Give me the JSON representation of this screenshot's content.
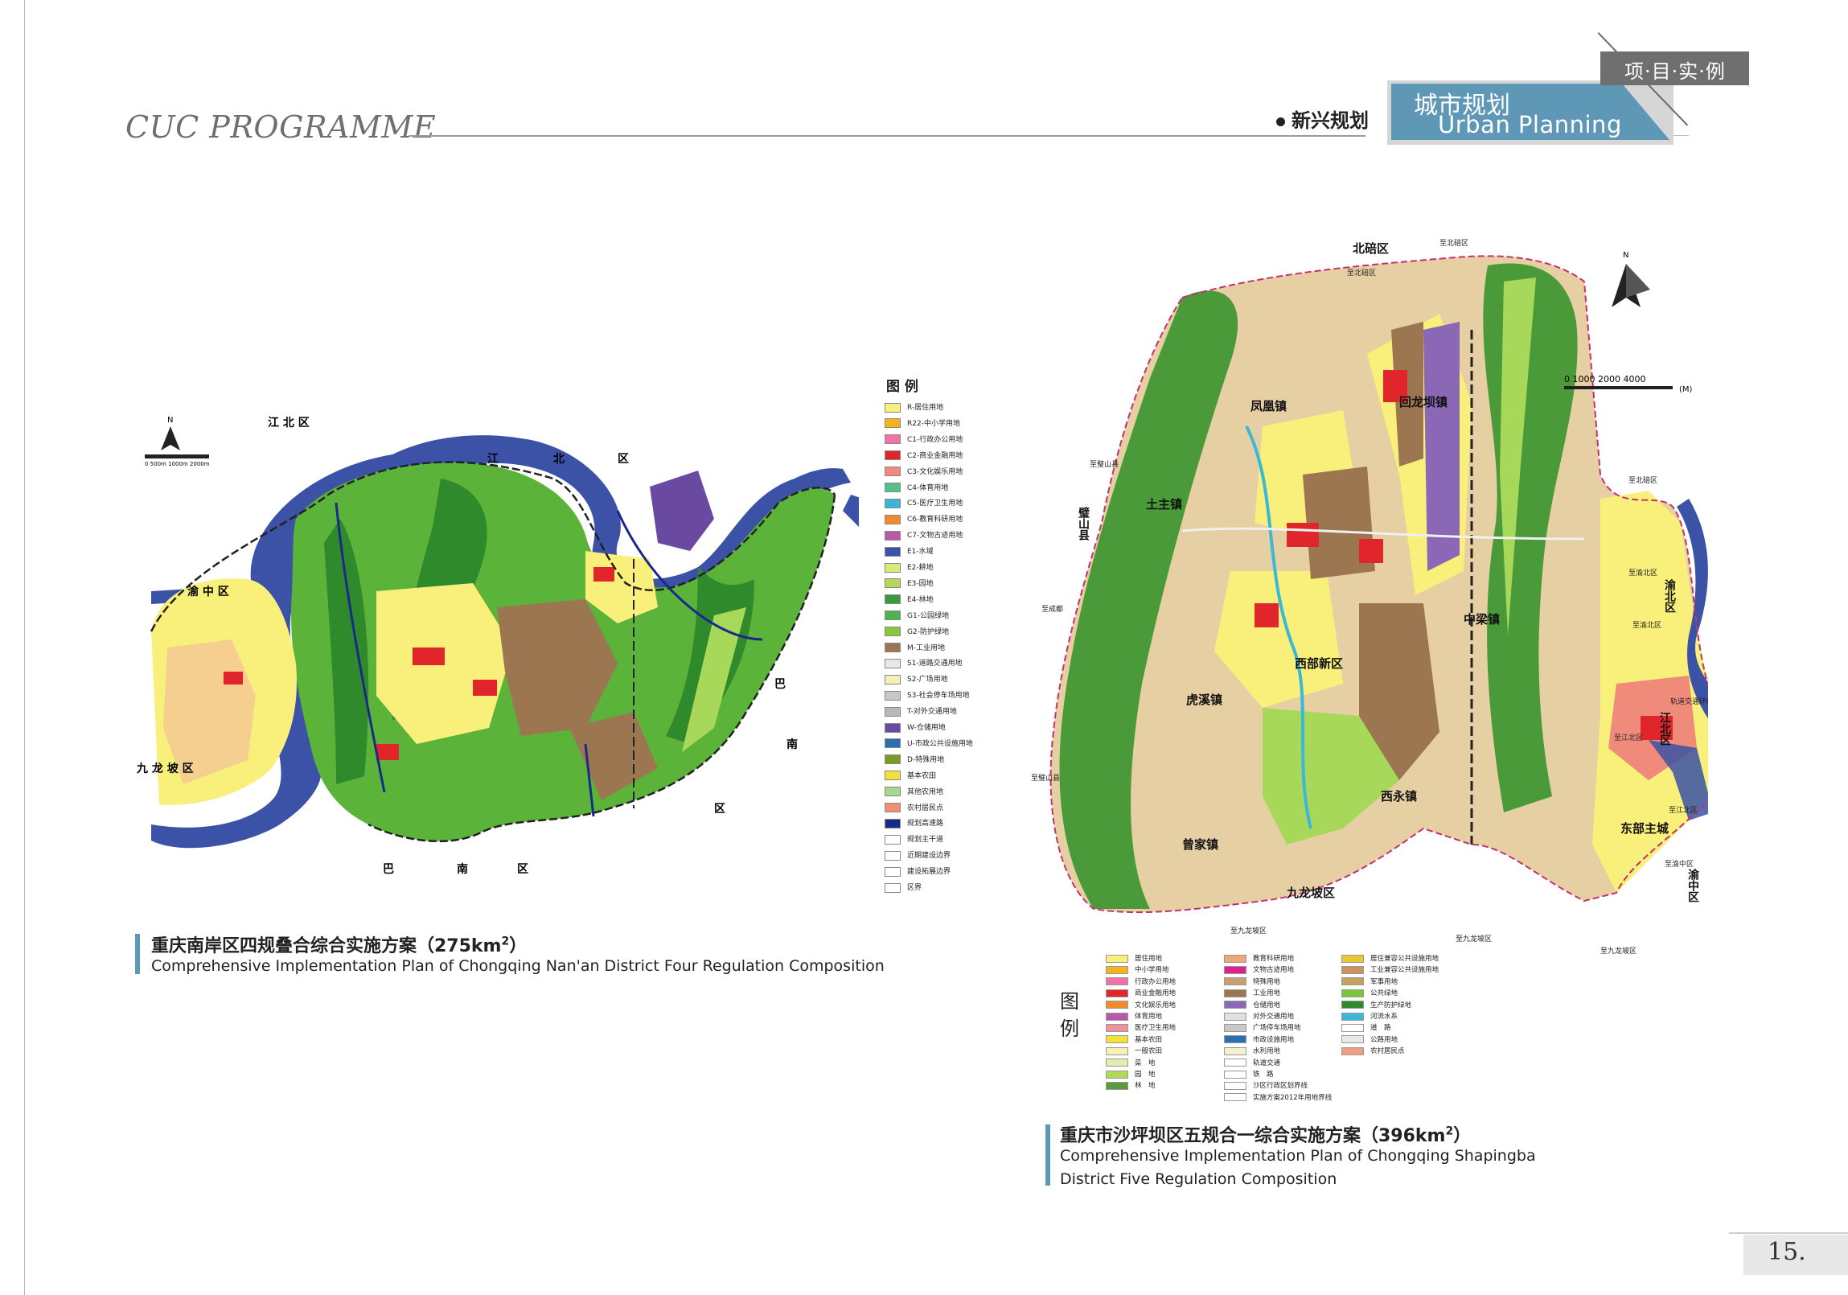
{
  "header": {
    "brand": "CUC PROGRAMME",
    "section": "新兴规划",
    "tab_cn": "城市规划",
    "tab_en": "Urban Planning",
    "project_tag": "项·目·实·例"
  },
  "colors": {
    "accent_blue": "#5f97b6",
    "river": "#3b52a6",
    "green_dark": "#2f8a2c",
    "green_mid": "#5bb33a",
    "green_light": "#a7d85a",
    "yellow": "#f2e23a",
    "red": "#e0262b",
    "brown": "#9c7650",
    "purple": "#8b68b5",
    "tan": "#e6cfa2",
    "grey": "#cfcfcf"
  },
  "map_a": {
    "north": "N",
    "scale": "0  500m 1000m       2000m",
    "labels": [
      "江 北 区",
      "江",
      "北",
      "区",
      "渝 中 区",
      "九 龙 坡 区",
      "巴",
      "南",
      "区",
      "巴",
      "南",
      "区"
    ],
    "legend_title": "图 例",
    "legend": [
      {
        "label": "R-居住用地",
        "color": "#f8f07a"
      },
      {
        "label": "R22-中小学用地",
        "color": "#f5b21a"
      },
      {
        "label": "C1-行政办公用地",
        "color": "#f072a8"
      },
      {
        "label": "C2-商业金融用地",
        "color": "#e0262b"
      },
      {
        "label": "C3-文化娱乐用地",
        "color": "#f08a7a"
      },
      {
        "label": "C4-体育用地",
        "color": "#57c08a"
      },
      {
        "label": "C5-医疗卫生用地",
        "color": "#3bb4d8"
      },
      {
        "label": "C6-教育科研用地",
        "color": "#f08a2a"
      },
      {
        "label": "C7-文物古迹用地",
        "color": "#b85aa8"
      },
      {
        "label": "E1-水域",
        "color": "#3b52a6"
      },
      {
        "label": "E2-耕地",
        "color": "#d7ea7a"
      },
      {
        "label": "E3-园地",
        "color": "#b5d85a"
      },
      {
        "label": "E4-林地",
        "color": "#3a9a3a"
      },
      {
        "label": "G1-公园绿地",
        "color": "#4db34a"
      },
      {
        "label": "G2-防护绿地",
        "color": "#8ac83a"
      },
      {
        "label": "M-工业用地",
        "color": "#9c7650"
      },
      {
        "label": "S1-道路交通用地",
        "color": "#e8e8e8"
      },
      {
        "label": "S2-广场用地",
        "color": "#f4f0b8"
      },
      {
        "label": "S3-社会停车场用地",
        "color": "#c8c8c8"
      },
      {
        "label": "T-对外交通用地",
        "color": "#b8b8b8"
      },
      {
        "label": "W-仓储用地",
        "color": "#6a4aa0"
      },
      {
        "label": "U-市政公共设施用地",
        "color": "#2a70b0"
      },
      {
        "label": "D-特殊用地",
        "color": "#7a9a2a"
      },
      {
        "label": "基本农田",
        "color": "#f2e23a"
      },
      {
        "label": "其他农用地",
        "color": "#a8d890"
      },
      {
        "label": "农村居民点",
        "color": "#f09070"
      },
      {
        "label": "规划高速路",
        "color": "#1a2a8a"
      },
      {
        "label": "规划主干道",
        "color": "#ffffff"
      },
      {
        "label": "近期建设边界",
        "color": "#ffffff"
      },
      {
        "label": "建设拓展边界",
        "color": "#ffffff"
      },
      {
        "label": "区界",
        "color": "#ffffff"
      }
    ],
    "caption_cn": "重庆南岸区四规叠合综合实施方案（275km",
    "caption_sup": "2",
    "caption_cn_tail": "）",
    "caption_en": "Comprehensive Implementation Plan of Chongqing Nan'an District Four Regulation Composition"
  },
  "map_b": {
    "north": "N",
    "scale": "0  1000 2000      4000",
    "scale_unit": "(M)",
    "labels": {
      "beibei": "北碚区",
      "to_beibei": "至北碚区",
      "to_beibei2": "至北碚区",
      "fenghuang": "凤凰镇",
      "huilong": "回龙坝镇",
      "bishan": "璧山县",
      "to_bishan": "至璧山县",
      "taiyuan": "土主镇",
      "xibu": "西部新区",
      "huxi": "虎溪镇",
      "zengjia": "曾家镇",
      "xiyong": "西永镇",
      "zhongliang": "中梁镇",
      "jiulongpo": "九龙坡区",
      "dongbu": "东部主城",
      "yubei": "渝北区",
      "jiangbei": "江北区",
      "yuzhong": "渝中区",
      "to_chengdu": "至成都",
      "to_bishan2": "至璧山县",
      "to_jiulongpo": "至九龙坡区",
      "to_jiulongpo2": "至九龙坡区",
      "to_jiulongpo3": "至九龙坡区",
      "to_yubei": "至渝北区",
      "to_yubei2": "至渝北区",
      "to_jiangbei": "至江北区",
      "to_jiangbei2": "至江北区",
      "to_yuzhong": "至渝中区",
      "rail": "轨道交通环线"
    },
    "legend_title": "图 例",
    "legend_cols": [
      [
        {
          "label": "居住用地",
          "color": "#f8f07a"
        },
        {
          "label": "中小学用地",
          "color": "#f5b21a"
        },
        {
          "label": "行政办公用地",
          "color": "#f072a8"
        },
        {
          "label": "商业金融用地",
          "color": "#e0262b"
        },
        {
          "label": "文化娱乐用地",
          "color": "#f08a2a"
        },
        {
          "label": "体育用地",
          "color": "#b85aa8"
        },
        {
          "label": "医疗卫生用地",
          "color": "#f090a0"
        },
        {
          "label": "基本农田",
          "color": "#f2e23a"
        },
        {
          "label": "一般农田",
          "color": "#f4f0b8"
        },
        {
          "label": "菜　地",
          "color": "#e0ecb0"
        },
        {
          "label": "园　地",
          "color": "#b5d85a"
        },
        {
          "label": "林　地",
          "color": "#5a9a3a"
        }
      ],
      [
        {
          "label": "教育科研用地",
          "color": "#f0a878"
        },
        {
          "label": "文物古迹用地",
          "color": "#e02090"
        },
        {
          "label": "特殊用地",
          "color": "#c8a070"
        },
        {
          "label": "工业用地",
          "color": "#9c7650"
        },
        {
          "label": "仓储用地",
          "color": "#8b68b5"
        },
        {
          "label": "对外交通用地",
          "color": "#e0e0e0"
        },
        {
          "label": "广场停车场用地",
          "color": "#c8c8c8"
        },
        {
          "label": "市政设施用地",
          "color": "#2a70b0"
        },
        {
          "label": "水利用地",
          "color": "#f4f0d0"
        },
        {
          "label": "轨道交通",
          "color": "#ffffff"
        },
        {
          "label": "铁　路",
          "color": "#ffffff"
        },
        {
          "label": "沙区行政区划界线",
          "color": "#ffffff"
        },
        {
          "label": "实施方案2012年用地界线",
          "color": "#ffffff"
        }
      ],
      [
        {
          "label": "居住兼容公共设施用地",
          "color": "#e8c830"
        },
        {
          "label": "工业兼容公共设施用地",
          "color": "#d09060"
        },
        {
          "label": "军事用地",
          "color": "#c8a060"
        },
        {
          "label": "公共绿地",
          "color": "#7ac83a"
        },
        {
          "label": "生产防护绿地",
          "color": "#2f8a2c"
        },
        {
          "label": "河流水系",
          "color": "#3bb8d8"
        },
        {
          "label": "道　路",
          "color": "#ffffff"
        },
        {
          "label": "公路用地",
          "color": "#e8e8e8"
        },
        {
          "label": "农村居民点",
          "color": "#f0a080"
        }
      ]
    ],
    "caption_cn": "重庆市沙坪坝区五规合一综合实施方案（396km",
    "caption_sup": "2",
    "caption_cn_tail": "）",
    "caption_en_1": "Comprehensive Implementation Plan of Chongqing Shapingba",
    "caption_en_2": "District Five Regulation Composition"
  },
  "page_number": "15."
}
